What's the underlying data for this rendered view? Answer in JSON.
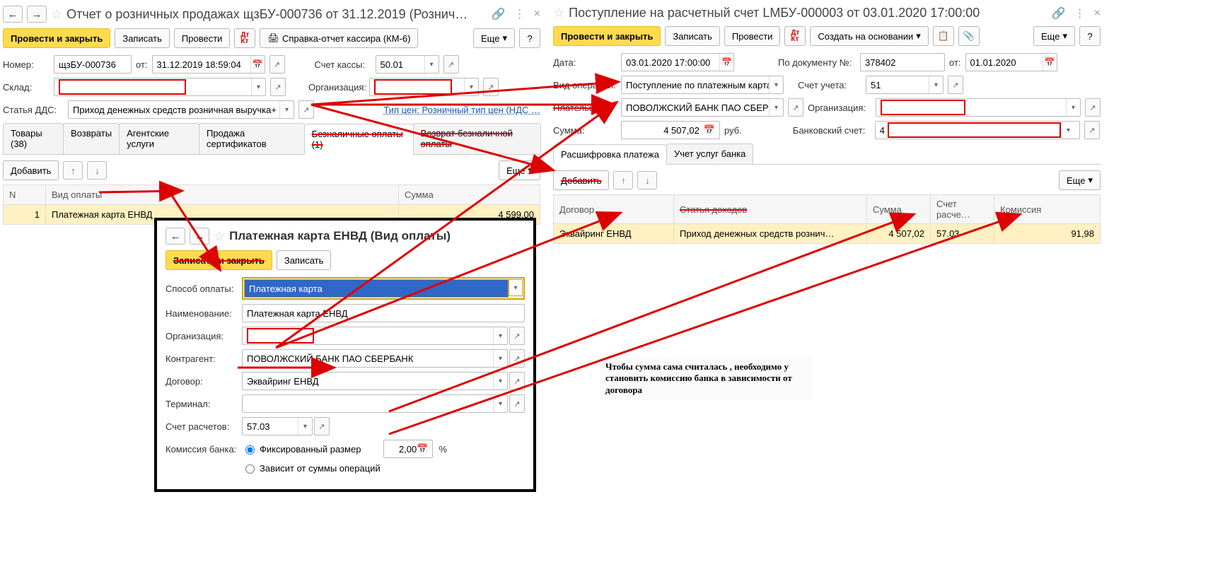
{
  "left": {
    "title": "Отчет о розничных продажах щзБУ-000736 от 31.12.2019 (Рознич…",
    "toolbar": {
      "post_close": "Провести и закрыть",
      "save": "Записать",
      "post": "Провести",
      "report": "Справка-отчет кассира (КМ-6)",
      "more": "Еще",
      "help": "?"
    },
    "fields": {
      "number_label": "Номер:",
      "number_value": "щзБУ-000736",
      "from_label": "от:",
      "date_value": "31.12.2019 18:59:04",
      "account_label": "Счет кассы:",
      "account_value": "50.01",
      "warehouse_label": "Склад:",
      "org_label": "Организация:",
      "dds_label": "Статья ДДС:",
      "dds_value": "Приход денежных средств розничная выручка+",
      "price_type_link": "Тип цен: Розничный тип цен (НДС …"
    },
    "tabs": {
      "goods": "Товары (38)",
      "returns": "Возвраты",
      "agent": "Агентские услуги",
      "certs": "Продажа сертификатов",
      "cashless": "Безналичные оплаты (1)",
      "cashless_return": "Возврат безналичной оплаты"
    },
    "subbar": {
      "add": "Добавить",
      "more": "Еще"
    },
    "grid": {
      "col_n": "N",
      "col_type": "Вид оплаты",
      "col_sum": "Сумма",
      "row": {
        "n": "1",
        "type": "Платежная карта ЕНВД",
        "sum": "4 599,00"
      }
    }
  },
  "right": {
    "title": "Поступление на расчетный счет LMБУ-000003 от 03.01.2020 17:00:00",
    "toolbar": {
      "post_close": "Провести и закрыть",
      "save": "Записать",
      "post": "Провести",
      "create_based": "Создать на основании",
      "more": "Еще",
      "help": "?"
    },
    "fields": {
      "date_label": "Дата:",
      "date_value": "03.01.2020 17:00:00",
      "doc_num_label": "По документу №:",
      "doc_num_value": "378402",
      "from_label": "от:",
      "from_value": "01.01.2020",
      "op_label": "Вид операции:",
      "op_value": "Поступление по платежным картам",
      "acct_label": "Счет учета:",
      "acct_value": "51",
      "payer_label": "Плательщик:",
      "payer_value": "ПОВОЛЖСКИЙ БАНК ПАО СБЕРБАН",
      "org_label": "Организация:",
      "sum_label": "Сумма:",
      "sum_value": "4 507,02",
      "currency": "руб.",
      "bank_acct_label": "Банковский счет:",
      "bank_acct_value": "4"
    },
    "tabs": {
      "breakdown": "Расшифровка платежа",
      "bank_services": "Учет услуг банка"
    },
    "subbar": {
      "add": "Добавить",
      "more": "Еще"
    },
    "grid": {
      "col_contract": "Договор",
      "col_income": "Статья доходов",
      "col_sum": "Сумма",
      "col_acct": "Счет расче…",
      "col_comm": "Комиссия",
      "row": {
        "contract": "Эквайринг ЕНВД",
        "income": "Приход денежных средств рознич…",
        "sum": "4 507,02",
        "acct": "57.03",
        "comm": "91,98"
      }
    }
  },
  "popup": {
    "title": "Платежная карта ЕНВД (Вид оплаты)",
    "save_close": "Записать и закрыть",
    "save": "Записать",
    "fields": {
      "method_label": "Способ оплаты:",
      "method_value": "Платежная карта",
      "name_label": "Наименование:",
      "name_value": "Платежная карта ЕНВД",
      "org_label": "Организация:",
      "counterparty_label": "Контрагент:",
      "counterparty_value": "ПОВОЛЖСКИЙ БАНК ПАО СБЕРБАНК",
      "contract_label": "Договор:",
      "contract_value": "Эквайринг ЕНВД",
      "terminal_label": "Терминал:",
      "acct_label": "Счет расчетов:",
      "acct_value": "57.03",
      "comm_label": "Комиссия банка:",
      "comm_fixed": "Фиксированный размер",
      "comm_value": "2,00",
      "comm_percent": "%",
      "comm_depends": "Зависит от суммы операций"
    }
  },
  "note": "Чтобы сумма сама считалась , необходимо у становить комиссию банка в зависимости от договора"
}
